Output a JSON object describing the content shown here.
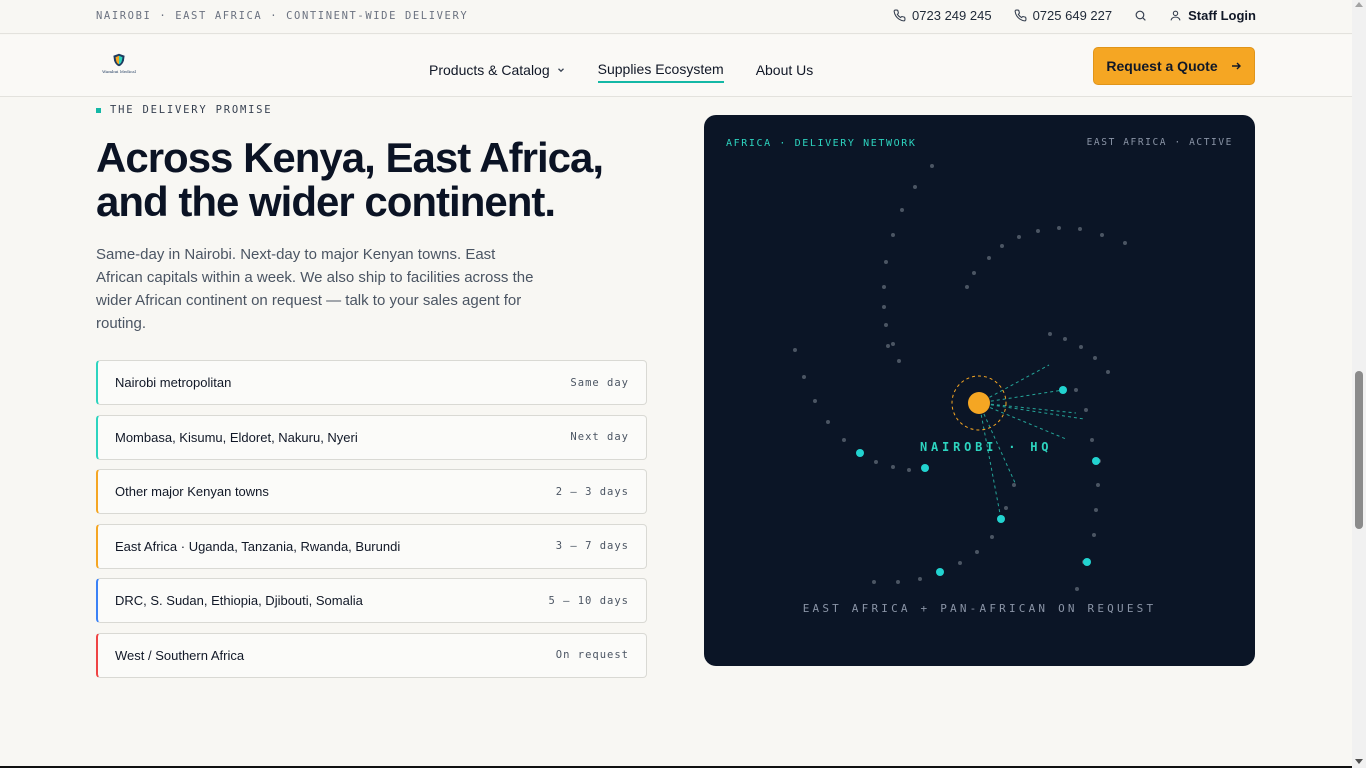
{
  "topbar": {
    "tagline": "NAIROBI · EAST AFRICA · CONTINENT-WIDE DELIVERY",
    "phone1": "0723 249 245",
    "phone2": "0725 649 227",
    "staff_login": "Staff Login"
  },
  "nav": {
    "logo_text": "Wambui Medical",
    "items": [
      {
        "label": "Products & Catalog",
        "icon": "chevron-down-icon"
      },
      {
        "label": "Supplies Ecosystem"
      },
      {
        "label": "About Us"
      }
    ],
    "cta": "Request a Quote"
  },
  "hero": {
    "eyebrow": "THE DELIVERY PROMISE",
    "headline": "Across Kenya, East Africa, and the wider continent.",
    "lede": "Same-day in Nairobi. Next-day to major Kenyan towns. East African capitals within a week. We also ship to facilities across the wider African continent on request — talk to your sales agent for routing."
  },
  "zones": [
    {
      "name": "Nairobi metropolitan",
      "eta": "Same day",
      "color": "#2dd4bf"
    },
    {
      "name": "Mombasa, Kisumu, Eldoret, Nakuru, Nyeri",
      "eta": "Next day",
      "color": "#2dd4bf"
    },
    {
      "name": "Other major Kenyan towns",
      "eta": "2 – 3 days",
      "color": "#f5a623"
    },
    {
      "name": "East Africa · Uganda, Tanzania, Rwanda, Burundi",
      "eta": "3 – 7 days",
      "color": "#f5a623"
    },
    {
      "name": "DRC, S. Sudan, Ethiopia, Djibouti, Somalia",
      "eta": "5 – 10 days",
      "color": "#3b82f6"
    },
    {
      "name": "West / Southern Africa",
      "eta": "On request",
      "color": "#ef4444"
    }
  ],
  "map": {
    "header_left": "AFRICA · DELIVERY NETWORK",
    "header_right": "EAST AFRICA · ACTIVE",
    "hq_label": "NAIROBI · HQ",
    "footer": "EAST AFRICA + PAN-AFRICAN ON REQUEST",
    "colors": {
      "hq": "#f5a623",
      "node": "#22d3d0",
      "outline": "#4b5563"
    }
  }
}
